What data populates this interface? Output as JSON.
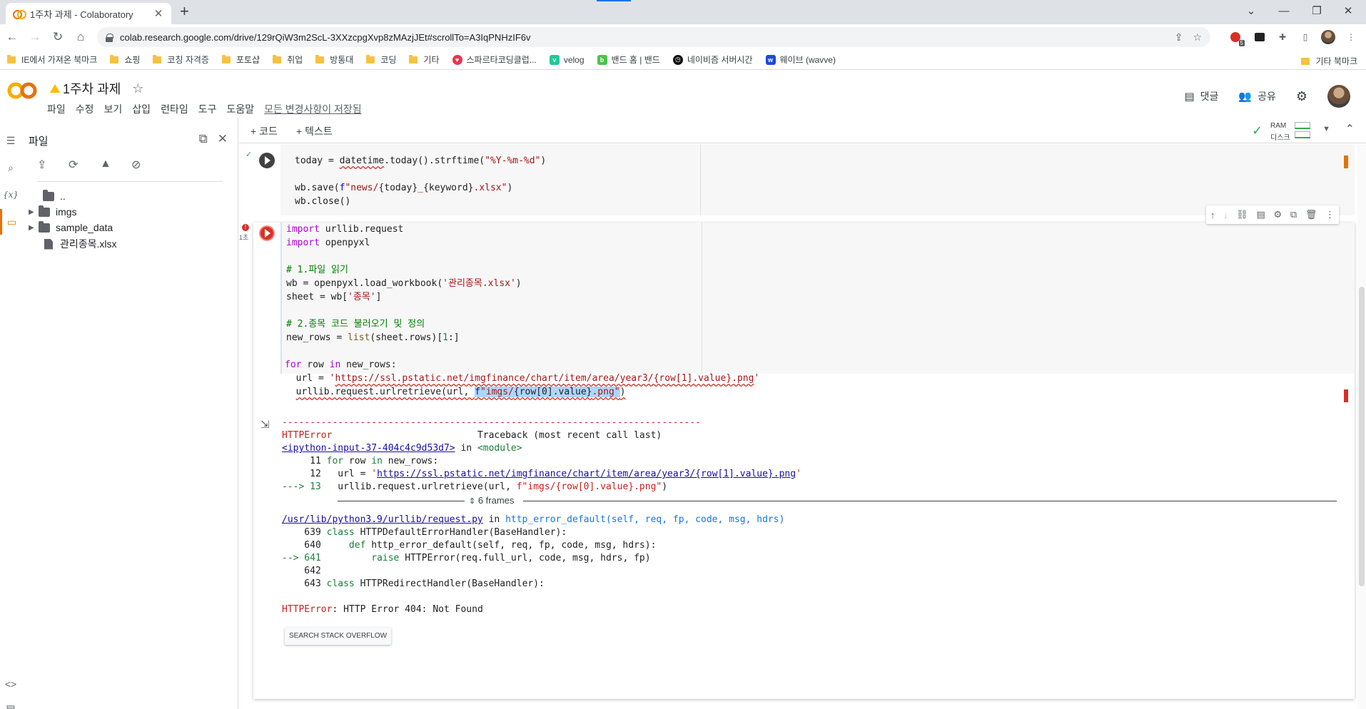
{
  "browser": {
    "tab_title": "1주차 과제 - Colaboratory",
    "tab_close": "✕",
    "new_tab": "+",
    "url": "colab.research.google.com/drive/129rQiW3m2ScL-3XXzcpgXvp8zMAzjJEt#scrollTo=A3IqPNHzIF6v",
    "ext_badge_count": "5"
  },
  "bookmarks": [
    {
      "label": "IE에서 가져온 북마크",
      "icon": "folder-icon"
    },
    {
      "label": "쇼핑",
      "icon": "folder-icon"
    },
    {
      "label": "코칭 자격증",
      "icon": "folder-icon"
    },
    {
      "label": "포토샵",
      "icon": "folder-icon"
    },
    {
      "label": "취업",
      "icon": "folder-icon"
    },
    {
      "label": "방통대",
      "icon": "folder-icon"
    },
    {
      "label": "코딩",
      "icon": "folder-icon"
    },
    {
      "label": "기타",
      "icon": "folder-icon"
    },
    {
      "label": "스파르타코딩클럽...",
      "icon": "sparta-icon",
      "color": "#e8344e"
    },
    {
      "label": "velog",
      "icon": "velog-icon",
      "color": "#20c997"
    },
    {
      "label": "밴드 홈 | 밴드",
      "icon": "band-icon",
      "color": "#4cc349"
    },
    {
      "label": "네이비즘 서버시간",
      "icon": "clock-icon",
      "color": "#111111"
    },
    {
      "label": "웨이브 (wavve)",
      "icon": "wavve-icon",
      "color": "#1a4bdb"
    }
  ],
  "bookmarks_other": "기타 북마크",
  "colab": {
    "logo": "CO",
    "title": "1주차 과제",
    "menu": [
      "파일",
      "수정",
      "보기",
      "삽입",
      "런타임",
      "도구",
      "도움말"
    ],
    "saved_status": "모든 변경사항이 저장됨",
    "comment_label": "댓글",
    "share_label": "공유",
    "add_code": "+ 코드",
    "add_text": "+ 텍스트",
    "ram_label": "RAM",
    "disk_label": "디스크"
  },
  "sidepanel": {
    "title": "파일",
    "tree": [
      {
        "name": "..",
        "type": "parent"
      },
      {
        "name": "imgs",
        "type": "folder"
      },
      {
        "name": "sample_data",
        "type": "folder"
      },
      {
        "name": "관리종목.xlsx",
        "type": "file"
      }
    ]
  },
  "cells": {
    "cell1": {
      "lines": [
        "today = datetime.today().strftime(\"%Y-%m-%d\")",
        "",
        "wb.save(f\"news/{today}_{keyword}.xlsx\")",
        "wb.close()"
      ]
    },
    "cell2": {
      "exec_label": "1초",
      "lines": [
        "import urllib.request",
        "import openpyxl",
        "",
        "# 1.파일 읽기",
        "wb = openpyxl.load_workbook('관리종목.xlsx')",
        "sheet = wb['종목']",
        "",
        "# 2.종목 코드 불러오기 및 정의",
        "new_rows = list(sheet.rows)[1:]",
        "",
        "for row in new_rows:",
        "  url = 'https://ssl.pstatic.net/imgfinance/chart/item/area/year3/{row[1].value}.png'",
        "  urllib.request.urlretrieve(url, f\"imgs/{row[0].value}.png\")"
      ]
    }
  },
  "output": {
    "dashes": "---------------------------------------------------------------------------",
    "error_name": "HTTPError",
    "traceback_header": "Traceback (most recent call last)",
    "input_link": "<ipython-input-37-404c4c9d53d7>",
    "in_text": " in ",
    "module_text": "<module>",
    "tb_lines": [
      "     11 for row in new_rows:",
      "     12   url = 'https://ssl.pstatic.net/imgfinance/chart/item/area/year3/{row[1].value}.png'",
      "---> 13   urllib.request.urlretrieve(url, f\"imgs/{row[0].value}.png\")"
    ],
    "frames_label": "6 frames",
    "lib_link": "/usr/lib/python3.9/urllib/request.py",
    "lib_func": "http_error_default(self, req, fp, code, msg, hdrs)",
    "lib_lines": [
      "    639 class HTTPDefaultErrorHandler(BaseHandler):",
      "    640     def http_error_default(self, req, fp, code, msg, hdrs):",
      "--> 641         raise HTTPError(req.full_url, code, msg, hdrs, fp)",
      "    642 ",
      "    643 class HTTPRedirectHandler(BaseHandler):"
    ],
    "final_error": "HTTPError",
    "final_msg": ": HTTP Error 404: Not Found",
    "so_button": "SEARCH STACK OVERFLOW"
  }
}
